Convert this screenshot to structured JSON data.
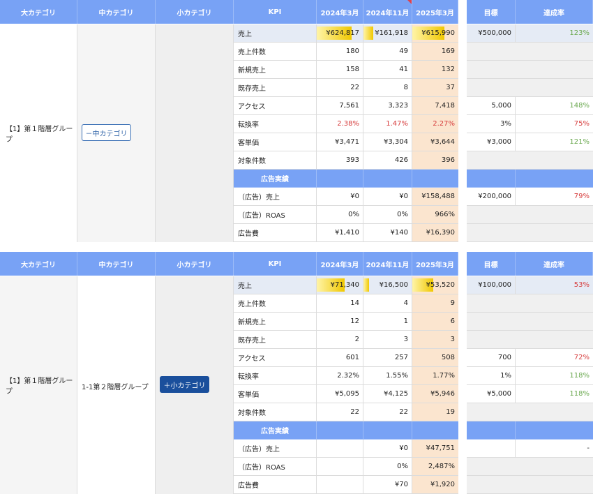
{
  "headers": {
    "major": "大カテゴリ",
    "middle": "中カテゴリ",
    "minor": "小カテゴリ",
    "kpi": "KPI",
    "p1": "2024年3月",
    "p2": "2024年11月",
    "p3": "2025年3月",
    "target": "目標",
    "achievement": "達成率"
  },
  "colors": {
    "header": "#78a2f5",
    "highlight_column": "#fbe5cf",
    "below_target": "#d63b3b",
    "above_target": "#6aa84f",
    "button_primary": "#1a4f9c"
  },
  "section1": {
    "major_label": "【1】第１階層グループ",
    "collapse_button": "－中カテゴリ",
    "rows": [
      {
        "kpi": "売上",
        "v1": "¥624,817",
        "v2": "¥161,918",
        "v3": "¥615,990",
        "target": "¥500,000",
        "ach": "123%",
        "bars": [
          0.75,
          0.2,
          0.7
        ]
      },
      {
        "kpi": "売上件数",
        "v1": "180",
        "v2": "49",
        "v3": "169",
        "target": "",
        "ach": ""
      },
      {
        "kpi": "新規売上",
        "v1": "158",
        "v2": "41",
        "v3": "132",
        "target": "",
        "ach": ""
      },
      {
        "kpi": "既存売上",
        "v1": "22",
        "v2": "8",
        "v3": "37",
        "target": "",
        "ach": ""
      },
      {
        "kpi": "アクセス",
        "v1": "7,561",
        "v2": "3,323",
        "v3": "7,418",
        "target": "5,000",
        "ach": "148%"
      },
      {
        "kpi": "転換率",
        "v1": "2.38%",
        "v2": "1.47%",
        "v3": "2.27%",
        "target": "3%",
        "ach": "75%"
      },
      {
        "kpi": "客単価",
        "v1": "¥3,471",
        "v2": "¥3,304",
        "v3": "¥3,644",
        "target": "¥3,000",
        "ach": "121%"
      },
      {
        "kpi": "対象件数",
        "v1": "393",
        "v2": "426",
        "v3": "396",
        "target": "",
        "ach": ""
      }
    ],
    "ad_header": "広告実績",
    "ad_rows": [
      {
        "kpi": "（広告）売上",
        "v1": "¥0",
        "v2": "¥0",
        "v3": "¥158,488",
        "target": "¥200,000",
        "ach": "79%"
      },
      {
        "kpi": "（広告）ROAS",
        "v1": "0%",
        "v2": "0%",
        "v3": "966%",
        "target": "",
        "ach": ""
      },
      {
        "kpi": "広告費",
        "v1": "¥1,410",
        "v2": "¥140",
        "v3": "¥16,390",
        "target": "",
        "ach": ""
      }
    ]
  },
  "section2": {
    "major_label": "【1】第１階層グループ",
    "middle_label": "1-1第２階層グループ",
    "expand_button": "＋小カテゴリ",
    "rows": [
      {
        "kpi": "売上",
        "v1": "¥71,340",
        "v2": "¥16,500",
        "v3": "¥53,520",
        "target": "¥100,000",
        "ach": "53%",
        "bars": [
          0.6,
          0.12,
          0.45
        ]
      },
      {
        "kpi": "売上件数",
        "v1": "14",
        "v2": "4",
        "v3": "9",
        "target": "",
        "ach": ""
      },
      {
        "kpi": "新規売上",
        "v1": "12",
        "v2": "1",
        "v3": "6",
        "target": "",
        "ach": ""
      },
      {
        "kpi": "既存売上",
        "v1": "2",
        "v2": "3",
        "v3": "3",
        "target": "",
        "ach": ""
      },
      {
        "kpi": "アクセス",
        "v1": "601",
        "v2": "257",
        "v3": "508",
        "target": "700",
        "ach": "72%"
      },
      {
        "kpi": "転換率",
        "v1": "2.32%",
        "v2": "1.55%",
        "v3": "1.77%",
        "target": "1%",
        "ach": "118%"
      },
      {
        "kpi": "客単価",
        "v1": "¥5,095",
        "v2": "¥4,125",
        "v3": "¥5,946",
        "target": "¥5,000",
        "ach": "118%"
      },
      {
        "kpi": "対象件数",
        "v1": "22",
        "v2": "22",
        "v3": "19",
        "target": "",
        "ach": ""
      }
    ],
    "ad_header": "広告実績",
    "ad_rows": [
      {
        "kpi": "（広告）売上",
        "v1": "",
        "v2": "¥0",
        "v3": "¥47,751",
        "target": "",
        "ach": "-"
      },
      {
        "kpi": "（広告）ROAS",
        "v1": "",
        "v2": "0%",
        "v3": "2,487%",
        "target": "",
        "ach": ""
      },
      {
        "kpi": "広告費",
        "v1": "",
        "v2": "¥70",
        "v3": "¥1,920",
        "target": "",
        "ach": ""
      }
    ]
  }
}
